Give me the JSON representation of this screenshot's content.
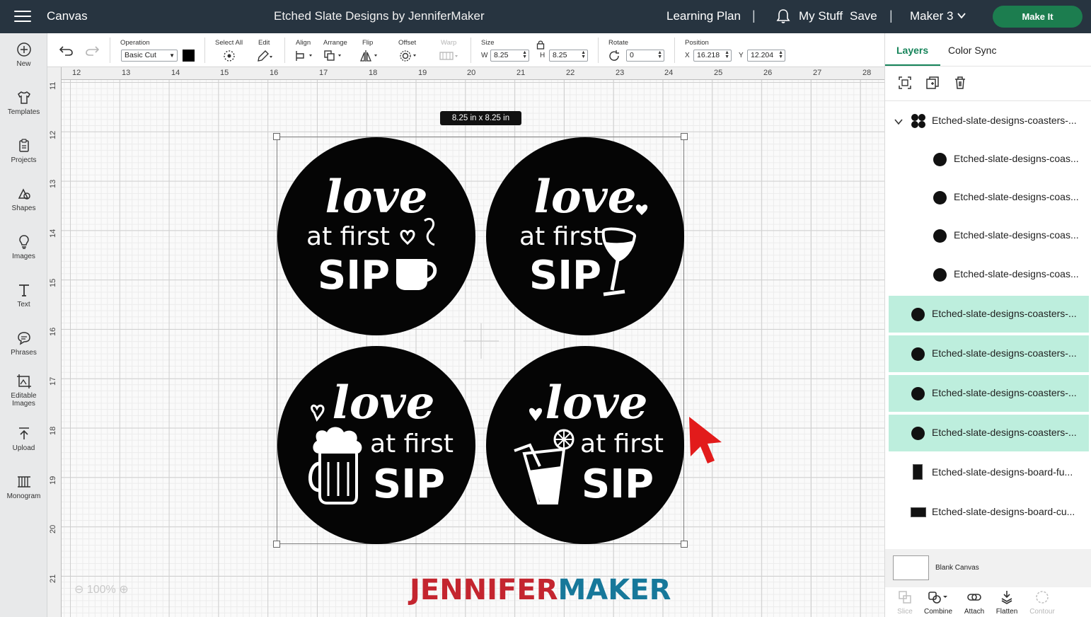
{
  "header": {
    "app_title": "Canvas",
    "document_title": "Etched Slate Designs by JenniferMaker",
    "learning_plan": "Learning Plan",
    "my_stuff": "My Stuff",
    "save": "Save",
    "machine": "Maker 3",
    "make_it": "Make It",
    "separator": "|"
  },
  "left_toolbar": {
    "new": "New",
    "templates": "Templates",
    "projects": "Projects",
    "shapes": "Shapes",
    "images": "Images",
    "text": "Text",
    "phrases": "Phrases",
    "editable_line1": "Editable",
    "editable_line2": "Images",
    "upload": "Upload",
    "monogram": "Monogram"
  },
  "edit_toolbar": {
    "operation_label": "Operation",
    "operation_value": "Basic Cut",
    "operation_color": "#000000",
    "select_all": "Select All",
    "edit": "Edit",
    "align": "Align",
    "arrange": "Arrange",
    "flip": "Flip",
    "offset": "Offset",
    "warp": "Warp",
    "size_label": "Size",
    "w_label": "W",
    "w_value": "8.25",
    "h_label": "H",
    "h_value": "8.25",
    "rotate_label": "Rotate",
    "rotate_value": "0",
    "position_label": "Position",
    "x_label": "X",
    "x_value": "16.218",
    "y_label": "Y",
    "y_value": "12.204"
  },
  "canvas": {
    "ruler_top": [
      "12",
      "13",
      "14",
      "15",
      "16",
      "17",
      "18",
      "19",
      "20",
      "21",
      "22",
      "23",
      "24",
      "25",
      "26",
      "27",
      "28"
    ],
    "ruler_left": [
      "11",
      "12",
      "13",
      "14",
      "15",
      "16",
      "17",
      "18",
      "19",
      "20",
      "21"
    ],
    "selection_size": "8.25  in x 8.25  in",
    "zoom": "100%",
    "brand_part1": "JENNIFER",
    "brand_part2": "MAKER",
    "coasters": [
      {
        "line1": "love",
        "line2": "at first",
        "line3": "SIP",
        "icon": "coffee-cup-icon"
      },
      {
        "line1": "love",
        "line2": "at first",
        "line3": "SIP",
        "icon": "wine-glass-icon"
      },
      {
        "line1": "love",
        "line2": "at first",
        "line3": "SIP",
        "icon": "beer-mug-icon"
      },
      {
        "line1": "love",
        "line2": "at first",
        "line3": "SIP",
        "icon": "cocktail-glass-icon"
      }
    ]
  },
  "layers_panel": {
    "tab_layers": "Layers",
    "tab_color_sync": "Color Sync",
    "group_name": "Etched-slate-designs-coasters-...",
    "layers": [
      {
        "name": "Etched-slate-designs-coas...",
        "selected": false,
        "child": true
      },
      {
        "name": "Etched-slate-designs-coas...",
        "selected": false,
        "child": true
      },
      {
        "name": "Etched-slate-designs-coas...",
        "selected": false,
        "child": true
      },
      {
        "name": "Etched-slate-designs-coas...",
        "selected": false,
        "child": true
      },
      {
        "name": "Etched-slate-designs-coasters-...",
        "selected": true,
        "child": false
      },
      {
        "name": "Etched-slate-designs-coasters-...",
        "selected": true,
        "child": false
      },
      {
        "name": "Etched-slate-designs-coasters-...",
        "selected": true,
        "child": false
      },
      {
        "name": "Etched-slate-designs-coasters-...",
        "selected": true,
        "child": false
      },
      {
        "name": "Etched-slate-designs-board-fu...",
        "selected": false,
        "child": false
      },
      {
        "name": "Etched-slate-designs-board-cu...",
        "selected": false,
        "child": false
      }
    ],
    "blank_canvas": "Blank Canvas",
    "bottom": {
      "slice": "Slice",
      "combine": "Combine",
      "attach": "Attach",
      "flatten": "Flatten",
      "contour": "Contour"
    }
  },
  "colors": {
    "header_bg": "#273440",
    "accent_green": "#16845a",
    "selected_layer": "#bdeedd",
    "brand_red": "#c4252f",
    "brand_blue": "#17789a"
  }
}
